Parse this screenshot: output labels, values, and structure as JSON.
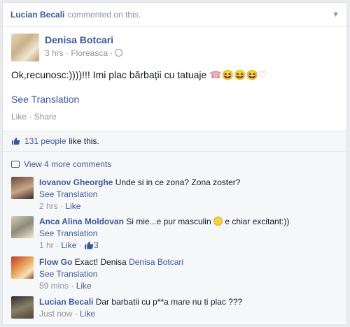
{
  "header": {
    "user": "Lucian Becali",
    "action": "commented on this.",
    "menu_icon": "chevron-down-icon"
  },
  "post": {
    "author": "Denisa Botcari",
    "time": "3 hrs · Floreasca ·",
    "text": "Ok,recunosc:))))!!! Imi plac bărbații cu tatuaje",
    "emoji": "☎😆😆😆♡",
    "see_translation": "See Translation",
    "like": "Like",
    "separator": " · ",
    "share": "Share"
  },
  "likes": {
    "count": "131 people",
    "suffix": "like this."
  },
  "view_more": "View 4 more comments",
  "comments": [
    {
      "name": "Iovanov Gheorghe",
      "text": "Unde si in ce zona? Zona zoster?",
      "translate": "See Translation",
      "time": "2 hrs",
      "like": "Like"
    },
    {
      "name": "Anca Alina Moldovan",
      "text": "Si mie...e pur masculin",
      "text2": "e chiar excitant:))",
      "translate": "See Translation",
      "time": "1 hr",
      "like": "Like",
      "like_count": "3"
    },
    {
      "name": "Flow Go",
      "text": "Exact! Denisa",
      "mention": "Denisa Botcari",
      "translate": "See Translation",
      "time": "59 mins",
      "like": "Like"
    },
    {
      "name": "Lucian Becali",
      "text": "Dar barbatii cu p**a mare nu ti plac ???",
      "time": "Just now",
      "like": "Like"
    }
  ],
  "colors": {
    "link": "#3b5998",
    "meta": "#90949c",
    "background": "#f6f7f9"
  }
}
